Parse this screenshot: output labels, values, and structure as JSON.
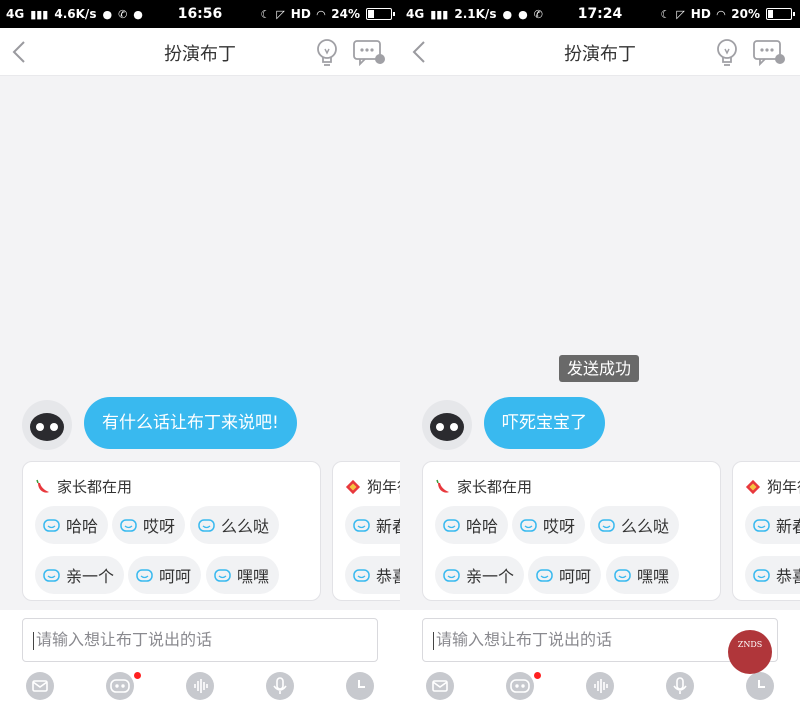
{
  "screens": [
    {
      "status": {
        "network": "4G",
        "speed": "4.6K/s",
        "time": "16:56",
        "hd": "HD",
        "battery": "24%",
        "battery_level": 0.24
      },
      "header": {
        "title": "扮演布丁"
      },
      "toast": "",
      "message": "有什么话让布丁来说吧!",
      "card": {
        "title": "家长都在用",
        "phrases": [
          "哈哈",
          "哎呀",
          "么么哒",
          "亲一个",
          "呵呵",
          "嘿嘿"
        ]
      },
      "peek_card": {
        "title": "狗年行",
        "phrases": [
          "新春",
          "恭喜"
        ]
      },
      "input": {
        "placeholder": "请输入想让布丁说出的话"
      }
    },
    {
      "status": {
        "network": "4G",
        "speed": "2.1K/s",
        "time": "17:24",
        "hd": "HD",
        "battery": "20%",
        "battery_level": 0.2
      },
      "header": {
        "title": "扮演布丁"
      },
      "toast": "发送成功",
      "message": "吓死宝宝了",
      "card": {
        "title": "家长都在用",
        "phrases": [
          "哈哈",
          "哎呀",
          "么么哒",
          "亲一个",
          "呵呵",
          "嘿嘿"
        ]
      },
      "peek_card": {
        "title": "狗年行",
        "phrases": [
          "新春",
          "恭喜"
        ]
      },
      "input": {
        "placeholder": "请输入想让布丁说出的话"
      }
    }
  ],
  "watermark": "ZNDS",
  "icons": {
    "back": "chevron-left-icon",
    "tips": "lightbulb-icon",
    "chat_settings": "chat-settings-icon",
    "family": "chili-icon",
    "new_year": "lantern-icon",
    "phrase": "smile-face-icon",
    "toolbar": [
      "mail-icon",
      "robot-icon",
      "voice-wave-icon",
      "microphone-icon",
      "clock-icon"
    ]
  },
  "colors": {
    "accent": "#39b9ef",
    "badge": "#ff2020",
    "toast_bg": "#505050",
    "toolbar_icon": "#c7c9ce"
  }
}
